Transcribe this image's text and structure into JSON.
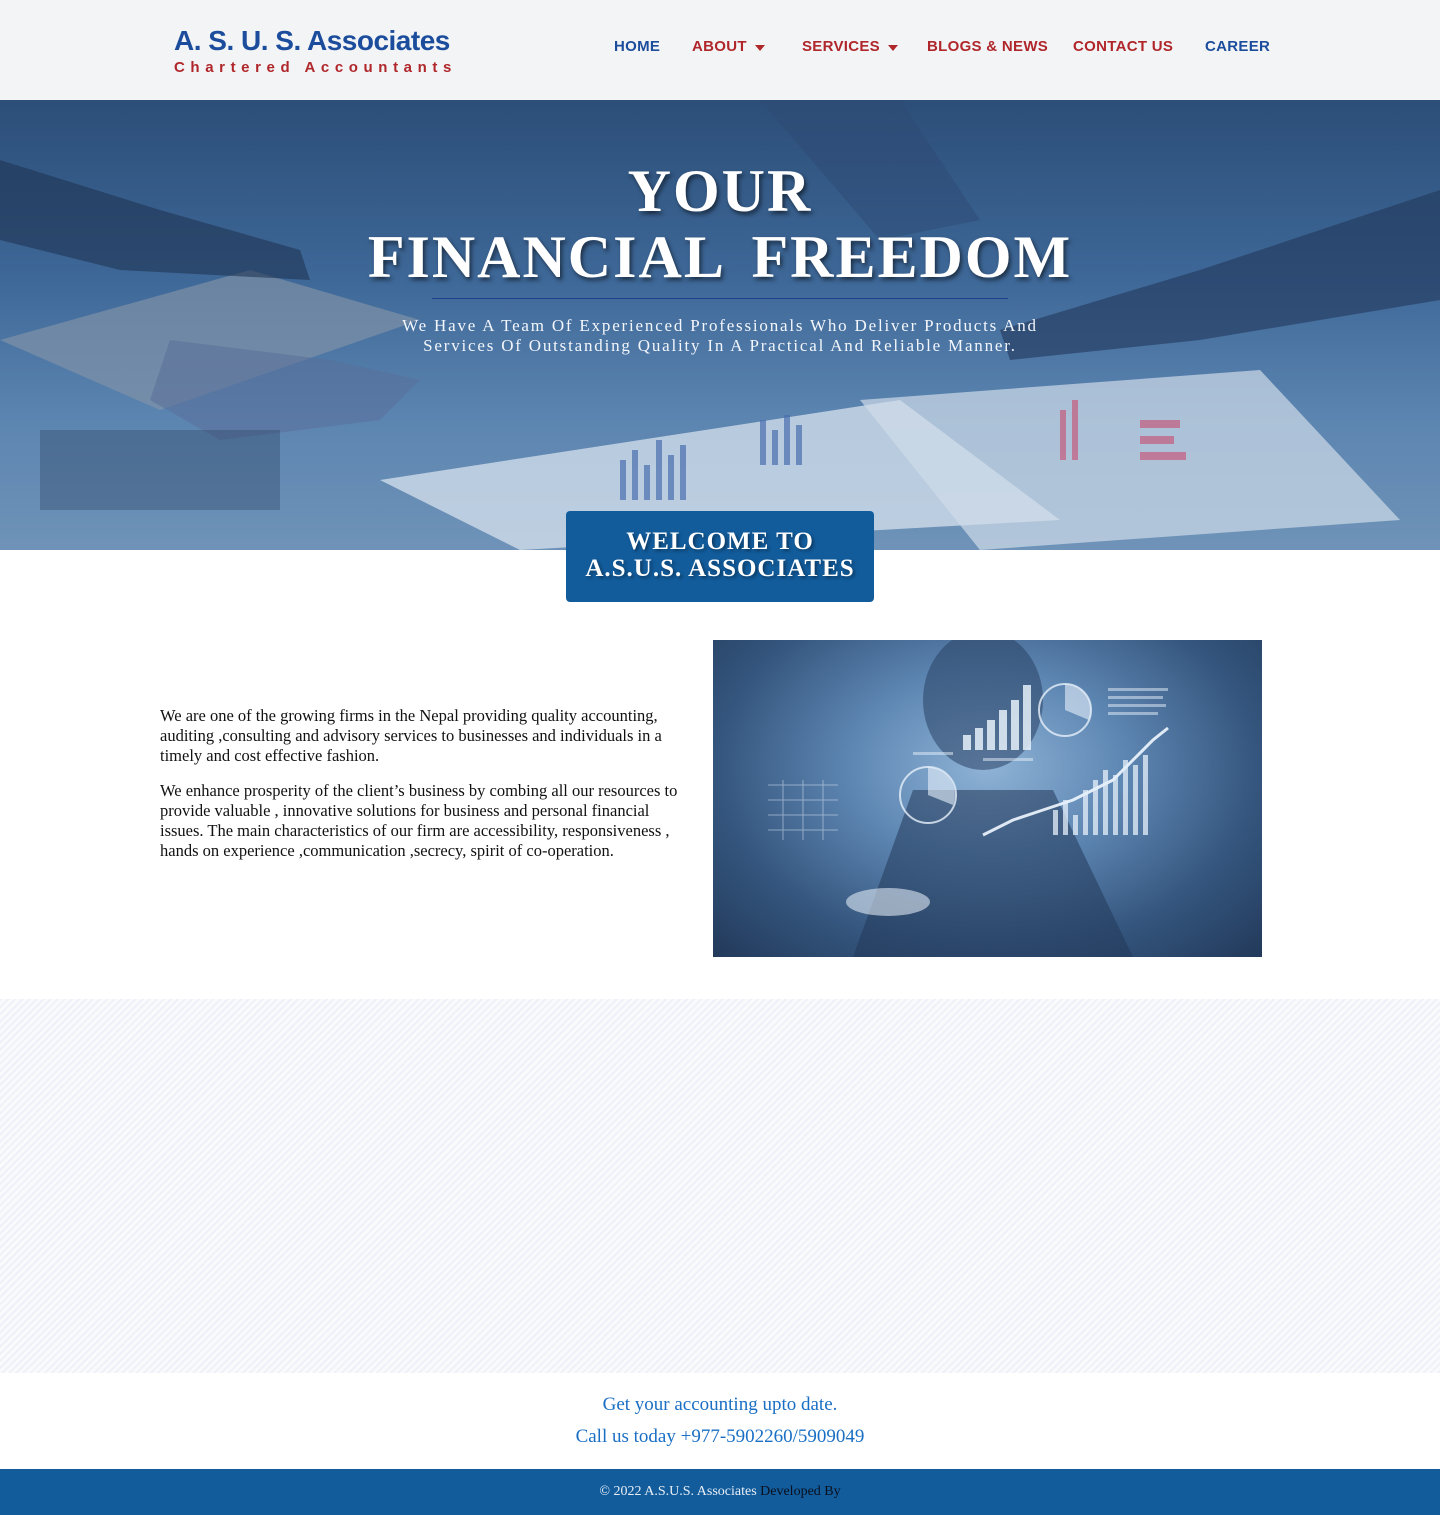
{
  "brand": {
    "name": "A. S. U. S. Associates",
    "tagline": "Chartered Accountants"
  },
  "nav": {
    "home": "HOME",
    "about": "ABOUT",
    "services": "SERVICES",
    "blogs": "BLOGS & NEWS",
    "contact": "CONTACT US",
    "career": "CAREER"
  },
  "colors": {
    "brand_blue": "#1b4d9c",
    "brand_red": "#b0272b",
    "accent_blue": "#125c9c",
    "cta_blue": "#1a6fc4"
  },
  "hero": {
    "line1": "YOUR",
    "line2": "FINANCIAL FREEDOM",
    "subtitle": "We Have A Team Of Experienced Professionals Who Deliver Products And Services Of Outstanding Quality In A Practical And Reliable Manner."
  },
  "welcome": {
    "line1": "WELCOME TO",
    "line2": "A.S.U.S. ASSOCIATES"
  },
  "about": {
    "paragraph1": "We are one of the growing firms in the Nepal  providing quality accounting, auditing ,consulting and advisory services to businesses and individuals in a timely and cost effective fashion.",
    "paragraph2": "We enhance prosperity of the client’s business by combing all our resources to provide valuable , innovative solutions for business and personal financial issues. The main characteristics of our firm are accessibility, responsiveness , hands on experience ,communication ,secrecy, spirit of co-operation."
  },
  "cta": {
    "line1": "Get your accounting upto date.",
    "line2": "Call us today +977-5902260/5909049"
  },
  "footer": {
    "copyright": "© 2022  A.S.U.S.  Associates",
    "developed_by": "Developed By"
  }
}
